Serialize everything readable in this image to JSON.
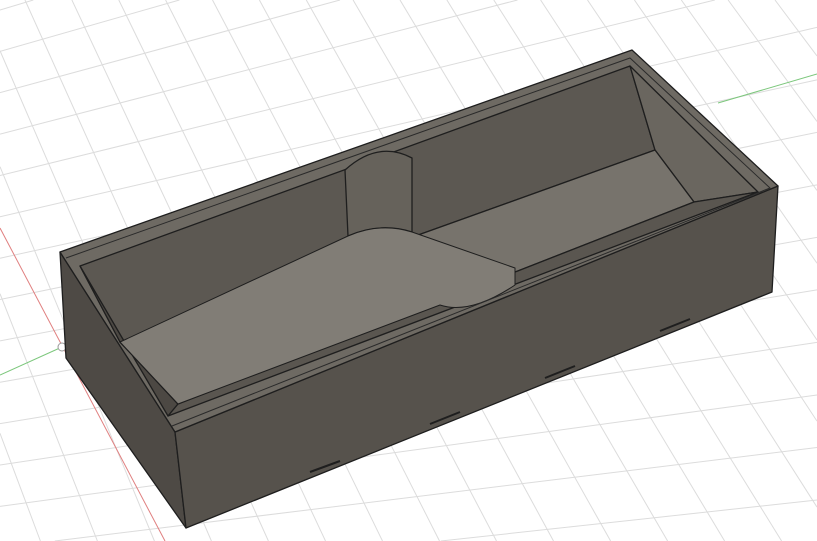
{
  "viewport": {
    "colors": {
      "background": "#ffffff",
      "grid": "#dcdcdc",
      "x_axis": "#e06060",
      "y_axis": "#6cc36c",
      "body_outer": "#56524c",
      "body_top": "#6e6a63",
      "inner_wall": "#5f5b55",
      "inner_floor": "#77736c",
      "edge": "#1e1e1e"
    }
  }
}
